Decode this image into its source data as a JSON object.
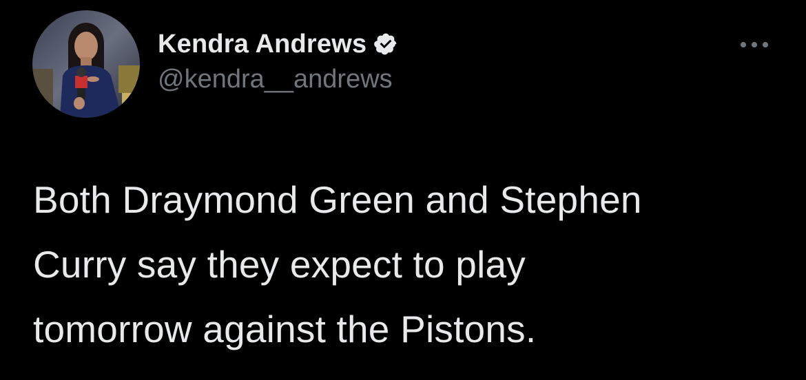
{
  "author": {
    "display_name": "Kendra Andrews",
    "handle": "@kendra__andrews",
    "verified": true,
    "avatar_icon": "profile-photo"
  },
  "tweet": {
    "text_lines": [
      "Both Draymond Green and Stephen",
      "Curry say they expect to play",
      "tomorrow against the Pistons."
    ]
  },
  "icons": {
    "more": "more-options-icon",
    "verified": "verified-badge-icon"
  },
  "colors": {
    "background": "#000000",
    "primary_text": "#e7e9ea",
    "secondary_text": "#71767b",
    "verified_badge": "#e7e9ea"
  }
}
